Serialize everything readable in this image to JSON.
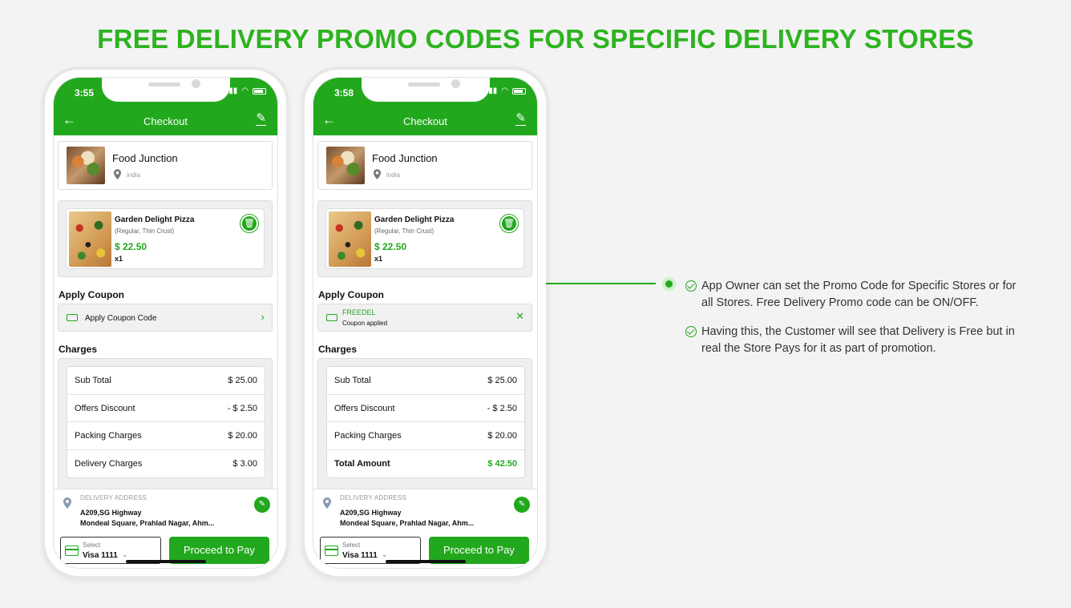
{
  "page": {
    "title": "FREE DELIVERY PROMO CODES FOR SPECIFIC DELIVERY STORES",
    "accent_color": "#22a81d",
    "title_color": "#2db31f"
  },
  "phones": [
    {
      "status_time": "3:55",
      "header": {
        "title": "Checkout",
        "back_icon": "arrow-left-icon",
        "edit_icon": "pencil-icon"
      },
      "store": {
        "name": "Food Junction",
        "location": "india"
      },
      "item": {
        "name": "Garden Delight Pizza",
        "options": "(Regular, Thin Crust)",
        "price": "$ 22.50",
        "qty": "x1"
      },
      "coupon": {
        "section_label": "Apply Coupon",
        "text": "Apply Coupon Code"
      },
      "charges": {
        "section_label": "Charges",
        "rows": [
          {
            "name": "Sub Total",
            "value": "$ 25.00"
          },
          {
            "name": "Offers Discount",
            "value": "- $ 2.50"
          },
          {
            "name": "Packing Charges",
            "value": "$ 20.00"
          },
          {
            "name": "Delivery Charges",
            "value": "$ 3.00"
          }
        ]
      },
      "address": {
        "label": "DELIVERY ADDRESS",
        "line1": "A209,SG Highway",
        "line2": "Mondeal Square, Prahlad Nagar, Ahm..."
      },
      "payment": {
        "select_label": "Select",
        "select_value": "Visa 1111",
        "button": "Proceed to Pay"
      }
    },
    {
      "status_time": "3:58",
      "header": {
        "title": "Checkout",
        "back_icon": "arrow-left-icon",
        "edit_icon": "pencil-icon"
      },
      "store": {
        "name": "Food Junction",
        "location": "india"
      },
      "item": {
        "name": "Garden Delight Pizza",
        "options": "(Regular, Thin Crust)",
        "price": "$ 22.50",
        "qty": "x1"
      },
      "coupon": {
        "section_label": "Apply Coupon",
        "code": "FREEDEL",
        "status": "Coupon applied"
      },
      "charges": {
        "section_label": "Charges",
        "rows": [
          {
            "name": "Sub Total",
            "value": "$ 25.00"
          },
          {
            "name": "Offers Discount",
            "value": "- $ 2.50"
          },
          {
            "name": "Packing Charges",
            "value": "$ 20.00"
          },
          {
            "name": "Total Amount",
            "value": "$ 42.50"
          }
        ]
      },
      "address": {
        "label": "DELIVERY ADDRESS",
        "line1": "A209,SG Highway",
        "line2": "Mondeal Square, Prahlad Nagar, Ahm..."
      },
      "payment": {
        "select_label": "Select",
        "select_value": "Visa 1111",
        "button": "Proceed to Pay"
      }
    }
  ],
  "features": [
    "App Owner can set the Promo Code for Specific Stores or for all Stores. Free Delivery Promo code can be ON/OFF.",
    "Having this, the Customer will see that Delivery is Free but in real the Store Pays for it as part of promotion."
  ]
}
